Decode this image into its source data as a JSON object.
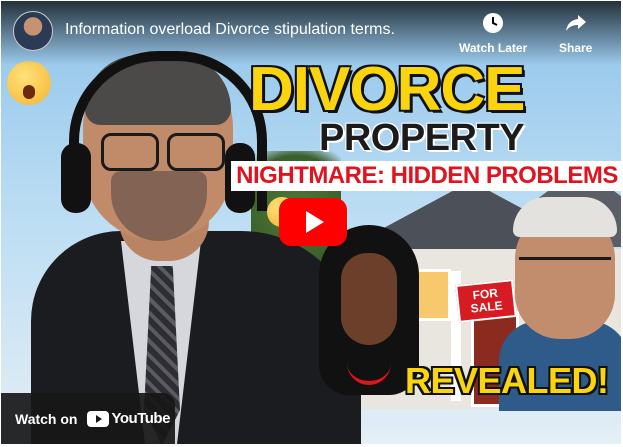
{
  "video": {
    "title": "Information overload Divorce stipulation terms.",
    "channel_avatar": "channel-avatar"
  },
  "controls": {
    "watch_later_label": "Watch Later",
    "watch_later_icon": "clock-icon",
    "share_label": "Share",
    "share_icon": "share-arrow-icon",
    "play_icon": "play-icon"
  },
  "thumbnail": {
    "headline_1": "DIVORCE",
    "headline_2": "PROPERTY",
    "banner": "NIGHTMARE: HIDDEN PROBLEMS",
    "sign_line_1": "FOR",
    "sign_line_2": "SALE",
    "revealed": "REVEALED!"
  },
  "footer": {
    "watch_on": "Watch on",
    "youtube": "YouTube"
  },
  "colors": {
    "play_red": "#ff0000",
    "headline_yellow": "#f9d40f",
    "banner_red": "#e0141e"
  }
}
